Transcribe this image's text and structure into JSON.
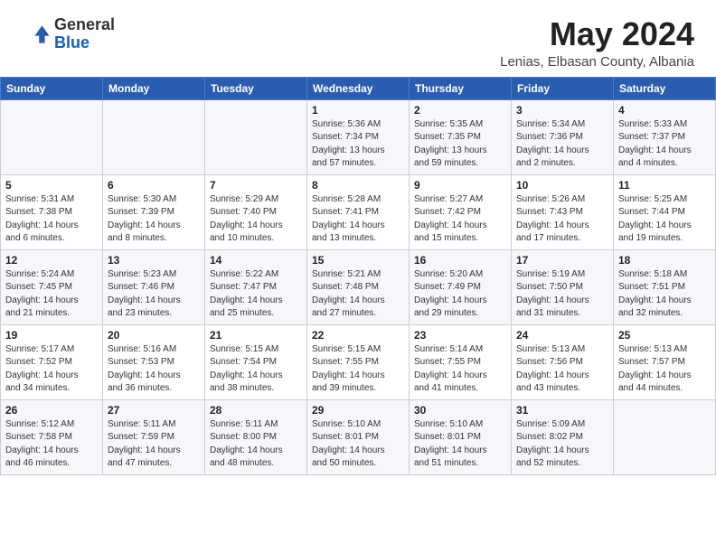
{
  "header": {
    "logo_general": "General",
    "logo_blue": "Blue",
    "month": "May 2024",
    "location": "Lenias, Elbasan County, Albania"
  },
  "weekdays": [
    "Sunday",
    "Monday",
    "Tuesday",
    "Wednesday",
    "Thursday",
    "Friday",
    "Saturday"
  ],
  "weeks": [
    [
      {
        "day": "",
        "info": ""
      },
      {
        "day": "",
        "info": ""
      },
      {
        "day": "",
        "info": ""
      },
      {
        "day": "1",
        "info": "Sunrise: 5:36 AM\nSunset: 7:34 PM\nDaylight: 13 hours\nand 57 minutes."
      },
      {
        "day": "2",
        "info": "Sunrise: 5:35 AM\nSunset: 7:35 PM\nDaylight: 13 hours\nand 59 minutes."
      },
      {
        "day": "3",
        "info": "Sunrise: 5:34 AM\nSunset: 7:36 PM\nDaylight: 14 hours\nand 2 minutes."
      },
      {
        "day": "4",
        "info": "Sunrise: 5:33 AM\nSunset: 7:37 PM\nDaylight: 14 hours\nand 4 minutes."
      }
    ],
    [
      {
        "day": "5",
        "info": "Sunrise: 5:31 AM\nSunset: 7:38 PM\nDaylight: 14 hours\nand 6 minutes."
      },
      {
        "day": "6",
        "info": "Sunrise: 5:30 AM\nSunset: 7:39 PM\nDaylight: 14 hours\nand 8 minutes."
      },
      {
        "day": "7",
        "info": "Sunrise: 5:29 AM\nSunset: 7:40 PM\nDaylight: 14 hours\nand 10 minutes."
      },
      {
        "day": "8",
        "info": "Sunrise: 5:28 AM\nSunset: 7:41 PM\nDaylight: 14 hours\nand 13 minutes."
      },
      {
        "day": "9",
        "info": "Sunrise: 5:27 AM\nSunset: 7:42 PM\nDaylight: 14 hours\nand 15 minutes."
      },
      {
        "day": "10",
        "info": "Sunrise: 5:26 AM\nSunset: 7:43 PM\nDaylight: 14 hours\nand 17 minutes."
      },
      {
        "day": "11",
        "info": "Sunrise: 5:25 AM\nSunset: 7:44 PM\nDaylight: 14 hours\nand 19 minutes."
      }
    ],
    [
      {
        "day": "12",
        "info": "Sunrise: 5:24 AM\nSunset: 7:45 PM\nDaylight: 14 hours\nand 21 minutes."
      },
      {
        "day": "13",
        "info": "Sunrise: 5:23 AM\nSunset: 7:46 PM\nDaylight: 14 hours\nand 23 minutes."
      },
      {
        "day": "14",
        "info": "Sunrise: 5:22 AM\nSunset: 7:47 PM\nDaylight: 14 hours\nand 25 minutes."
      },
      {
        "day": "15",
        "info": "Sunrise: 5:21 AM\nSunset: 7:48 PM\nDaylight: 14 hours\nand 27 minutes."
      },
      {
        "day": "16",
        "info": "Sunrise: 5:20 AM\nSunset: 7:49 PM\nDaylight: 14 hours\nand 29 minutes."
      },
      {
        "day": "17",
        "info": "Sunrise: 5:19 AM\nSunset: 7:50 PM\nDaylight: 14 hours\nand 31 minutes."
      },
      {
        "day": "18",
        "info": "Sunrise: 5:18 AM\nSunset: 7:51 PM\nDaylight: 14 hours\nand 32 minutes."
      }
    ],
    [
      {
        "day": "19",
        "info": "Sunrise: 5:17 AM\nSunset: 7:52 PM\nDaylight: 14 hours\nand 34 minutes."
      },
      {
        "day": "20",
        "info": "Sunrise: 5:16 AM\nSunset: 7:53 PM\nDaylight: 14 hours\nand 36 minutes."
      },
      {
        "day": "21",
        "info": "Sunrise: 5:15 AM\nSunset: 7:54 PM\nDaylight: 14 hours\nand 38 minutes."
      },
      {
        "day": "22",
        "info": "Sunrise: 5:15 AM\nSunset: 7:55 PM\nDaylight: 14 hours\nand 39 minutes."
      },
      {
        "day": "23",
        "info": "Sunrise: 5:14 AM\nSunset: 7:55 PM\nDaylight: 14 hours\nand 41 minutes."
      },
      {
        "day": "24",
        "info": "Sunrise: 5:13 AM\nSunset: 7:56 PM\nDaylight: 14 hours\nand 43 minutes."
      },
      {
        "day": "25",
        "info": "Sunrise: 5:13 AM\nSunset: 7:57 PM\nDaylight: 14 hours\nand 44 minutes."
      }
    ],
    [
      {
        "day": "26",
        "info": "Sunrise: 5:12 AM\nSunset: 7:58 PM\nDaylight: 14 hours\nand 46 minutes."
      },
      {
        "day": "27",
        "info": "Sunrise: 5:11 AM\nSunset: 7:59 PM\nDaylight: 14 hours\nand 47 minutes."
      },
      {
        "day": "28",
        "info": "Sunrise: 5:11 AM\nSunset: 8:00 PM\nDaylight: 14 hours\nand 48 minutes."
      },
      {
        "day": "29",
        "info": "Sunrise: 5:10 AM\nSunset: 8:01 PM\nDaylight: 14 hours\nand 50 minutes."
      },
      {
        "day": "30",
        "info": "Sunrise: 5:10 AM\nSunset: 8:01 PM\nDaylight: 14 hours\nand 51 minutes."
      },
      {
        "day": "31",
        "info": "Sunrise: 5:09 AM\nSunset: 8:02 PM\nDaylight: 14 hours\nand 52 minutes."
      },
      {
        "day": "",
        "info": ""
      }
    ]
  ]
}
